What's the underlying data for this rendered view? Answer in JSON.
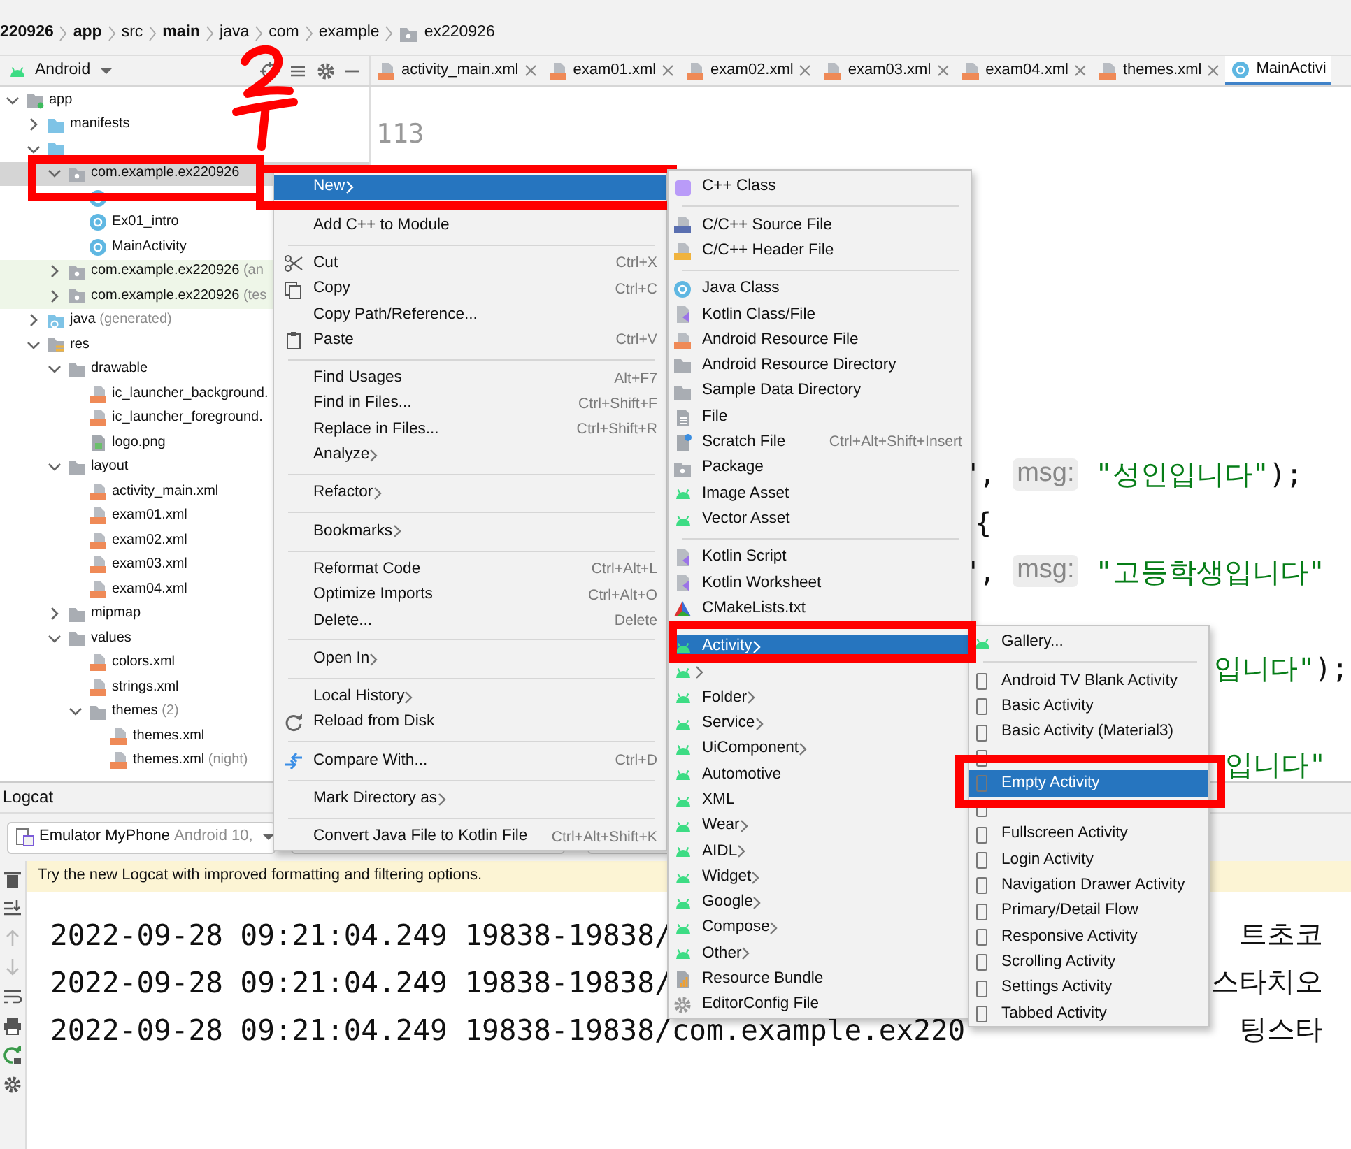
{
  "breadcrumb": [
    {
      "label": "220926",
      "bold": true,
      "kind": "text"
    },
    {
      "label": "app",
      "bold": true,
      "kind": "text"
    },
    {
      "label": "src",
      "bold": false,
      "kind": "text"
    },
    {
      "label": "main",
      "bold": true,
      "kind": "text"
    },
    {
      "label": "java",
      "bold": false,
      "kind": "text"
    },
    {
      "label": "com",
      "bold": false,
      "kind": "text"
    },
    {
      "label": "example",
      "bold": false,
      "kind": "text"
    },
    {
      "label": "ex220926",
      "bold": false,
      "kind": "package"
    }
  ],
  "project_panel": {
    "view": "Android",
    "tree": [
      {
        "label": "app",
        "kind": "module",
        "expanded": true,
        "selected": false,
        "children": [
          {
            "label": "manifests",
            "kind": "srcfolder",
            "expanded": false,
            "selected": false
          },
          {
            "kind": "srcfolder",
            "expanded": true,
            "selected": false,
            "children": [
              {
                "label": "com.example.ex220926",
                "kind": "package",
                "expanded": true,
                "selected": true,
                "children": [
                  {
                    "kind": "class",
                    "selected": false
                  },
                  {
                    "label": "Ex01_intro",
                    "kind": "class",
                    "selected": false
                  },
                  {
                    "label": "MainActivity",
                    "kind": "class",
                    "selected": false
                  }
                ]
              },
              {
                "label": "com.example.ex220926",
                "note": "(an",
                "kind": "package",
                "expanded": false,
                "selected": false,
                "color": "#eef6e8"
              },
              {
                "label": "com.example.ex220926",
                "note": "(tes",
                "kind": "package",
                "expanded": false,
                "selected": false,
                "color": "#eef6e8"
              }
            ]
          },
          {
            "label": "java",
            "note": "(generated)",
            "kind": "generated",
            "expanded": false,
            "selected": false
          },
          {
            "label": "res",
            "kind": "res",
            "expanded": true,
            "selected": false,
            "children": [
              {
                "label": "drawable",
                "kind": "folder",
                "expanded": true,
                "selected": false,
                "children": [
                  {
                    "label": "ic_launcher_background.",
                    "kind": "xml",
                    "selected": false
                  },
                  {
                    "label": "ic_launcher_foreground.",
                    "kind": "xml",
                    "selected": false
                  },
                  {
                    "label": "logo.png",
                    "kind": "image",
                    "selected": false
                  }
                ]
              },
              {
                "label": "layout",
                "kind": "folder",
                "expanded": true,
                "selected": false,
                "children": [
                  {
                    "label": "activity_main.xml",
                    "kind": "xml",
                    "selected": false
                  },
                  {
                    "label": "exam01.xml",
                    "kind": "xml",
                    "selected": false
                  },
                  {
                    "label": "exam02.xml",
                    "kind": "xml",
                    "selected": false
                  },
                  {
                    "label": "exam03.xml",
                    "kind": "xml",
                    "selected": false
                  },
                  {
                    "label": "exam04.xml",
                    "kind": "xml",
                    "selected": false
                  }
                ]
              },
              {
                "label": "mipmap",
                "kind": "folder",
                "expanded": false,
                "selected": false
              },
              {
                "label": "values",
                "kind": "folder",
                "expanded": true,
                "selected": false,
                "children": [
                  {
                    "label": "colors.xml",
                    "kind": "xml",
                    "selected": false
                  },
                  {
                    "label": "strings.xml",
                    "kind": "xml",
                    "selected": false
                  },
                  {
                    "label": "themes",
                    "note": "(2)",
                    "kind": "folder",
                    "expanded": true,
                    "selected": false,
                    "children": [
                      {
                        "label": "themes.xml",
                        "kind": "xml",
                        "selected": false
                      },
                      {
                        "label": "themes.xml",
                        "note": "(night)",
                        "kind": "xml",
                        "selected": false
                      }
                    ]
                  }
                ]
              }
            ]
          }
        ]
      }
    ]
  },
  "editor_tabs": [
    {
      "label": "activity_main.xml",
      "kind": "xml",
      "selected": false
    },
    {
      "label": "exam01.xml",
      "kind": "xml",
      "selected": false
    },
    {
      "label": "exam02.xml",
      "kind": "xml",
      "selected": false
    },
    {
      "label": "exam03.xml",
      "kind": "xml",
      "selected": false
    },
    {
      "label": "exam04.xml",
      "kind": "xml",
      "selected": false
    },
    {
      "label": "themes.xml",
      "kind": "xml",
      "selected": false
    },
    {
      "label": "MainActivi",
      "kind": "class",
      "selected": true
    }
  ],
  "editor": {
    "line_numbers": [
      "113"
    ],
    "code_lines": [
      {
        "parts": [
          {
            "text": "\",",
            "kind": "plain"
          },
          {
            "text": "msg:",
            "kind": "hint"
          },
          {
            "text": "\"성인입니다\"",
            "kind": "string"
          },
          {
            "text": ");",
            "kind": "plain"
          }
        ]
      },
      {
        "parts": [
          {
            "text": "{",
            "kind": "plain"
          }
        ]
      },
      {
        "parts": [
          {
            "text": "\",",
            "kind": "plain"
          },
          {
            "text": "msg:",
            "kind": "hint"
          },
          {
            "text": "\"고등학생입니다\"",
            "kind": "string"
          }
        ]
      },
      {
        "parts": [
          {
            "text": "입니다\"",
            "kind": "string"
          },
          {
            "text": ");",
            "kind": "plain"
          }
        ]
      },
      {
        "parts": [
          {
            "text": "입니다\"",
            "kind": "string"
          }
        ]
      }
    ]
  },
  "logcat": {
    "title": "Logcat",
    "device": {
      "name": "Emulator MyPhone",
      "detail": "Android 10,"
    },
    "banner": "Try the new Logcat with improved formatting and filtering options.",
    "entries": [
      {
        "text": "2022-09-28 09:21:04.249 19838-19838/",
        "message": "트초코"
      },
      {
        "text": "2022-09-28 09:21:04.249 19838-19838/",
        "message": "스타치오"
      },
      {
        "text": "2022-09-28 09:21:04.249 19838-19838/com.example.ex220",
        "message": "팅스타"
      }
    ]
  },
  "context_menu": {
    "groups": [
      [
        {
          "label": "New",
          "kind": "plain",
          "submenu": true,
          "selected": true
        }
      ],
      [
        {
          "label": "Add C++ to Module",
          "kind": "plain",
          "submenu": false,
          "selected": false
        }
      ],
      [
        {
          "label": "Cut",
          "shortcut": "Ctrl+X",
          "kind": "scissors",
          "submenu": false,
          "selected": false
        },
        {
          "label": "Copy",
          "shortcut": "Ctrl+C",
          "kind": "copy",
          "submenu": false,
          "selected": false
        },
        {
          "label": "Copy Path/Reference...",
          "kind": "plain",
          "submenu": false,
          "selected": false
        },
        {
          "label": "Paste",
          "shortcut": "Ctrl+V",
          "kind": "clipboard",
          "submenu": false,
          "selected": false
        }
      ],
      [
        {
          "label": "Find Usages",
          "shortcut": "Alt+F7",
          "kind": "plain",
          "submenu": false,
          "selected": false
        },
        {
          "label": "Find in Files...",
          "shortcut": "Ctrl+Shift+F",
          "kind": "plain",
          "submenu": false,
          "selected": false
        },
        {
          "label": "Replace in Files...",
          "shortcut": "Ctrl+Shift+R",
          "kind": "plain",
          "submenu": false,
          "selected": false
        },
        {
          "label": "Analyze",
          "kind": "plain",
          "submenu": true,
          "selected": false
        }
      ],
      [
        {
          "label": "Refactor",
          "kind": "plain",
          "submenu": true,
          "selected": false
        }
      ],
      [
        {
          "label": "Bookmarks",
          "kind": "plain",
          "submenu": true,
          "selected": false
        }
      ],
      [
        {
          "label": "Reformat Code",
          "shortcut": "Ctrl+Alt+L",
          "kind": "plain",
          "submenu": false,
          "selected": false
        },
        {
          "label": "Optimize Imports",
          "shortcut": "Ctrl+Alt+O",
          "kind": "plain",
          "submenu": false,
          "selected": false
        },
        {
          "label": "Delete...",
          "shortcut": "Delete",
          "kind": "plain",
          "submenu": false,
          "selected": false
        }
      ],
      [
        {
          "label": "Open In",
          "kind": "plain",
          "submenu": true,
          "selected": false
        }
      ],
      [
        {
          "label": "Local History",
          "kind": "plain",
          "submenu": true,
          "selected": false
        },
        {
          "label": "Reload from Disk",
          "kind": "reload",
          "submenu": false,
          "selected": false
        }
      ],
      [
        {
          "label": "Compare With...",
          "shortcut": "Ctrl+D",
          "kind": "compare",
          "submenu": false,
          "selected": false
        }
      ],
      [
        {
          "label": "Mark Directory as",
          "kind": "plain",
          "submenu": true,
          "selected": false
        }
      ],
      [
        {
          "label": "Convert Java File to Kotlin File",
          "shortcut": "Ctrl+Alt+Shift+K",
          "kind": "plain",
          "submenu": false,
          "selected": false
        }
      ]
    ]
  },
  "new_submenu": {
    "groups": [
      [
        {
          "label": "C++ Class",
          "kind": "cppclass",
          "submenu": false,
          "selected": false
        }
      ],
      [
        {
          "label": "C/C++ Source File",
          "kind": "cfile",
          "submenu": false,
          "selected": false
        },
        {
          "label": "C/C++ Header File",
          "kind": "hfile",
          "submenu": false,
          "selected": false
        }
      ],
      [
        {
          "label": "Java Class",
          "kind": "javaclass",
          "submenu": false,
          "selected": false
        },
        {
          "label": "Kotlin Class/File",
          "kind": "kotlin",
          "submenu": false,
          "selected": false
        },
        {
          "label": "Android Resource File",
          "kind": "resfile",
          "submenu": false,
          "selected": false
        },
        {
          "label": "Android Resource Directory",
          "kind": "folder",
          "submenu": false,
          "selected": false
        },
        {
          "label": "Sample Data Directory",
          "kind": "folder",
          "submenu": false,
          "selected": false
        },
        {
          "label": "File",
          "kind": "file",
          "submenu": false,
          "selected": false
        },
        {
          "label": "Scratch File",
          "shortcut": "Ctrl+Alt+Shift+Insert",
          "kind": "scratch",
          "submenu": false,
          "selected": false
        },
        {
          "label": "Package",
          "kind": "package",
          "submenu": false,
          "selected": false
        },
        {
          "label": "Image Asset",
          "kind": "android",
          "submenu": false,
          "selected": false
        },
        {
          "label": "Vector Asset",
          "kind": "android",
          "submenu": false,
          "selected": false
        }
      ],
      [
        {
          "label": "Kotlin Script",
          "kind": "kotlin",
          "submenu": false,
          "selected": false
        },
        {
          "label": "Kotlin Worksheet",
          "kind": "kotlin",
          "submenu": false,
          "selected": false
        },
        {
          "label": "CMakeLists.txt",
          "kind": "cmake",
          "submenu": false,
          "selected": false
        }
      ],
      [
        {
          "label": "Activity",
          "kind": "android",
          "submenu": true,
          "selected": true
        },
        {
          "kind": "android",
          "submenu": true,
          "selected": false
        },
        {
          "label": "Folder",
          "kind": "android",
          "submenu": true,
          "selected": false
        },
        {
          "label": "Service",
          "kind": "android",
          "submenu": true,
          "selected": false
        },
        {
          "label": "UiComponent",
          "kind": "android",
          "submenu": true,
          "selected": false
        },
        {
          "label": "Automotive",
          "kind": "android",
          "submenu": false,
          "selected": false
        },
        {
          "label": "XML",
          "kind": "android",
          "submenu": false,
          "selected": false
        },
        {
          "label": "Wear",
          "kind": "android",
          "submenu": true,
          "selected": false
        },
        {
          "label": "AIDL",
          "kind": "android",
          "submenu": true,
          "selected": false
        },
        {
          "label": "Widget",
          "kind": "android",
          "submenu": true,
          "selected": false
        },
        {
          "label": "Google",
          "kind": "android",
          "submenu": true,
          "selected": false
        },
        {
          "label": "Compose",
          "kind": "android",
          "submenu": true,
          "selected": false
        },
        {
          "label": "Other",
          "kind": "android",
          "submenu": true,
          "selected": false
        },
        {
          "label": "Resource Bundle",
          "kind": "bundle",
          "submenu": false,
          "selected": false
        },
        {
          "label": "EditorConfig File",
          "kind": "gear",
          "submenu": false,
          "selected": false
        }
      ]
    ]
  },
  "activity_submenu": {
    "groups": [
      [
        {
          "label": "Gallery...",
          "kind": "android",
          "submenu": false,
          "selected": false
        }
      ],
      [
        {
          "label": "Android TV Blank Activity",
          "kind": "phone",
          "submenu": false,
          "selected": false
        },
        {
          "label": "Basic Activity",
          "kind": "phone",
          "submenu": false,
          "selected": false
        },
        {
          "label": "Basic Activity (Material3)",
          "kind": "phone",
          "submenu": false,
          "selected": false
        },
        {
          "kind": "phone",
          "submenu": false,
          "selected": false
        },
        {
          "label": "Empty Activity",
          "kind": "phone",
          "submenu": false,
          "selected": true
        },
        {
          "kind": "phone",
          "submenu": false,
          "selected": false
        },
        {
          "label": "Fullscreen Activity",
          "kind": "phone",
          "submenu": false,
          "selected": false
        },
        {
          "label": "Login Activity",
          "kind": "phone",
          "submenu": false,
          "selected": false
        },
        {
          "label": "Navigation Drawer Activity",
          "kind": "phone",
          "submenu": false,
          "selected": false
        },
        {
          "label": "Primary/Detail Flow",
          "kind": "phone",
          "submenu": false,
          "selected": false
        },
        {
          "label": "Responsive Activity",
          "kind": "phone",
          "submenu": false,
          "selected": false
        },
        {
          "label": "Scrolling Activity",
          "kind": "phone",
          "submenu": false,
          "selected": false
        },
        {
          "label": "Settings Activity",
          "kind": "phone",
          "submenu": false,
          "selected": false
        },
        {
          "label": "Tabbed Activity",
          "kind": "phone",
          "submenu": false,
          "selected": false
        }
      ]
    ]
  }
}
